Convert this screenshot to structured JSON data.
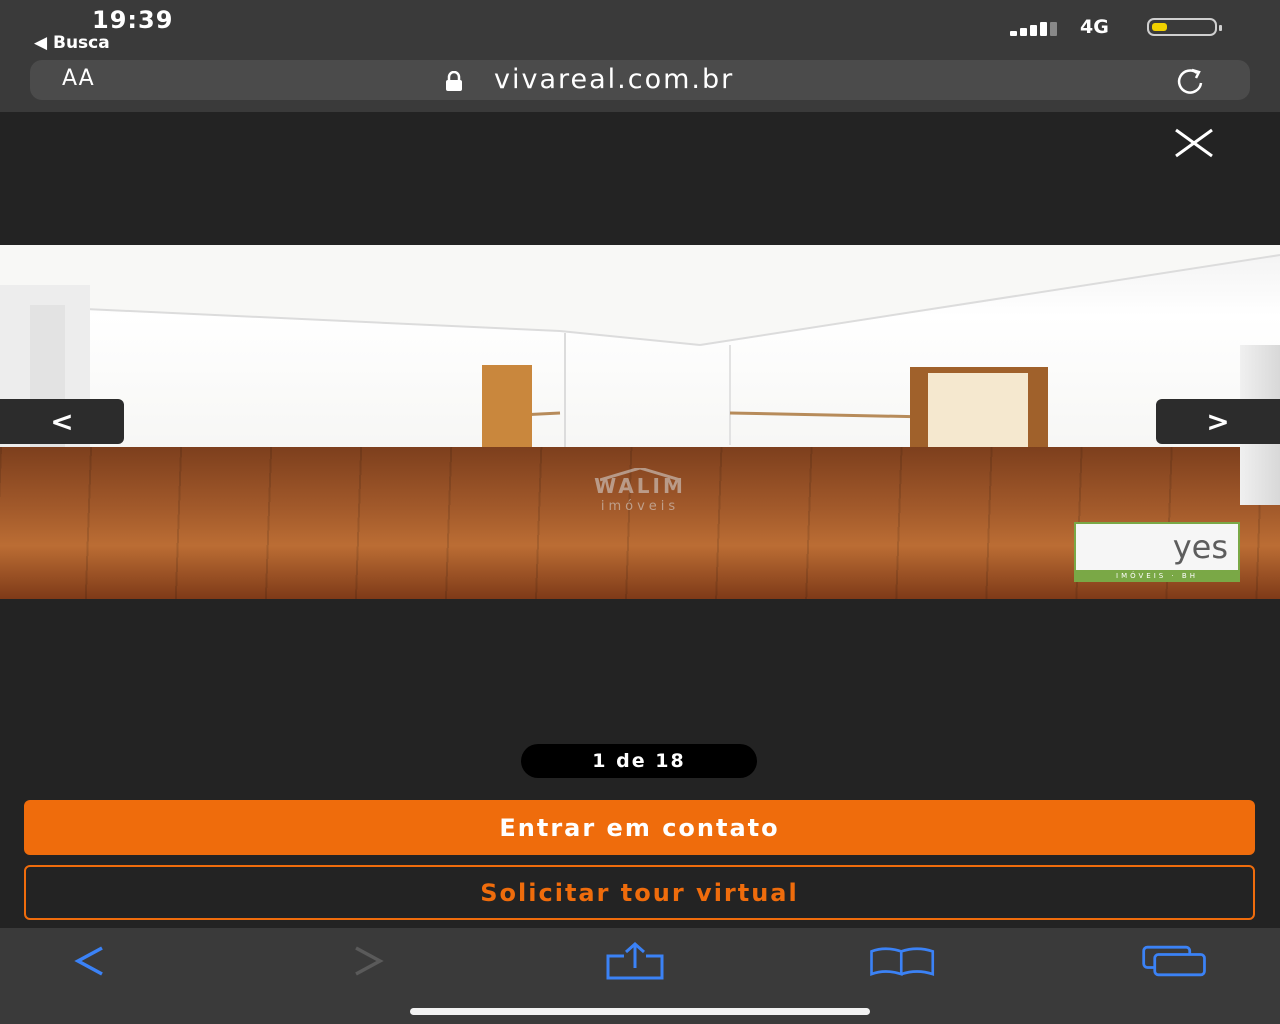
{
  "status_bar": {
    "time": "19:39",
    "back_app": "◀ Busca",
    "network": "4G",
    "battery_level": 0.25,
    "battery_color": "#f0d000"
  },
  "browser": {
    "aa_label": "AA",
    "url": "vivareal.com.br",
    "lock_icon": "lock-icon",
    "reload_icon": "reload-icon"
  },
  "gallery": {
    "close_icon": "close-icon",
    "prev_label": "<",
    "next_label": ">",
    "counter": "1 de 18",
    "watermark_title": "WALIM",
    "watermark_sub": "imóveis",
    "badge_text": "yes",
    "badge_sub": "IMÓVEIS · BH"
  },
  "actions": {
    "contact_label": "Entrar em contato",
    "tour_label": "Solicitar tour virtual",
    "accent_color": "#ef6c0c"
  },
  "toolbar": {
    "icons": [
      "back-arrow-icon",
      "forward-arrow-icon",
      "share-icon",
      "bookmarks-icon",
      "tabs-icon"
    ],
    "active_color": "#3b82f6"
  }
}
